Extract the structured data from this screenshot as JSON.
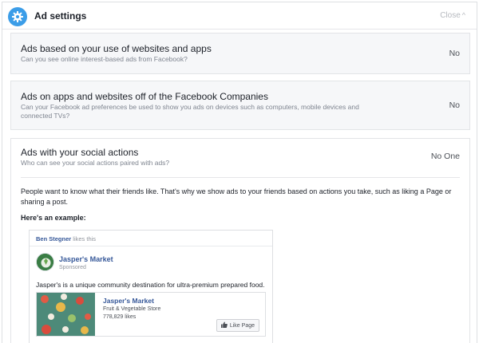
{
  "header": {
    "title": "Ad settings",
    "close_label": "Close",
    "close_chevron": "^"
  },
  "rows": [
    {
      "title": "Ads based on your use of websites and apps",
      "subtitle": "Can you see online interest-based ads from Facebook?",
      "value": "No"
    },
    {
      "title": "Ads on apps and websites off of the Facebook Companies",
      "subtitle": "Can your Facebook ad preferences be used to show you ads on devices such as computers, mobile devices and connected TVs?",
      "value": "No"
    }
  ],
  "social": {
    "title": "Ads with your social actions",
    "subtitle": "Who can see your social actions paired with ads?",
    "value": "No One",
    "explanation": "People want to know what their friends like. That's why we show ads to your friends based on actions you take, such as liking a Page or sharing a post.",
    "example_label": "Here's an example:"
  },
  "example_ad": {
    "friend_name": "Ben Stegner",
    "friend_action": "likes this",
    "page_name": "Jasper's Market",
    "sponsored": "Sponsored",
    "text": "Jasper's is a unique community destination for ultra-premium prepared food.",
    "attachment": {
      "name": "Jasper's Market",
      "category": "Fruit & Vegetable Store",
      "likes": "778,829 likes",
      "like_button": "Like Page"
    }
  },
  "colors": {
    "accent": "#3b9de8",
    "link": "#365899",
    "thumb_bg": "#4d8a79"
  },
  "icons": [
    "gear-icon",
    "chevron-up-icon",
    "thumbs-up-icon"
  ]
}
